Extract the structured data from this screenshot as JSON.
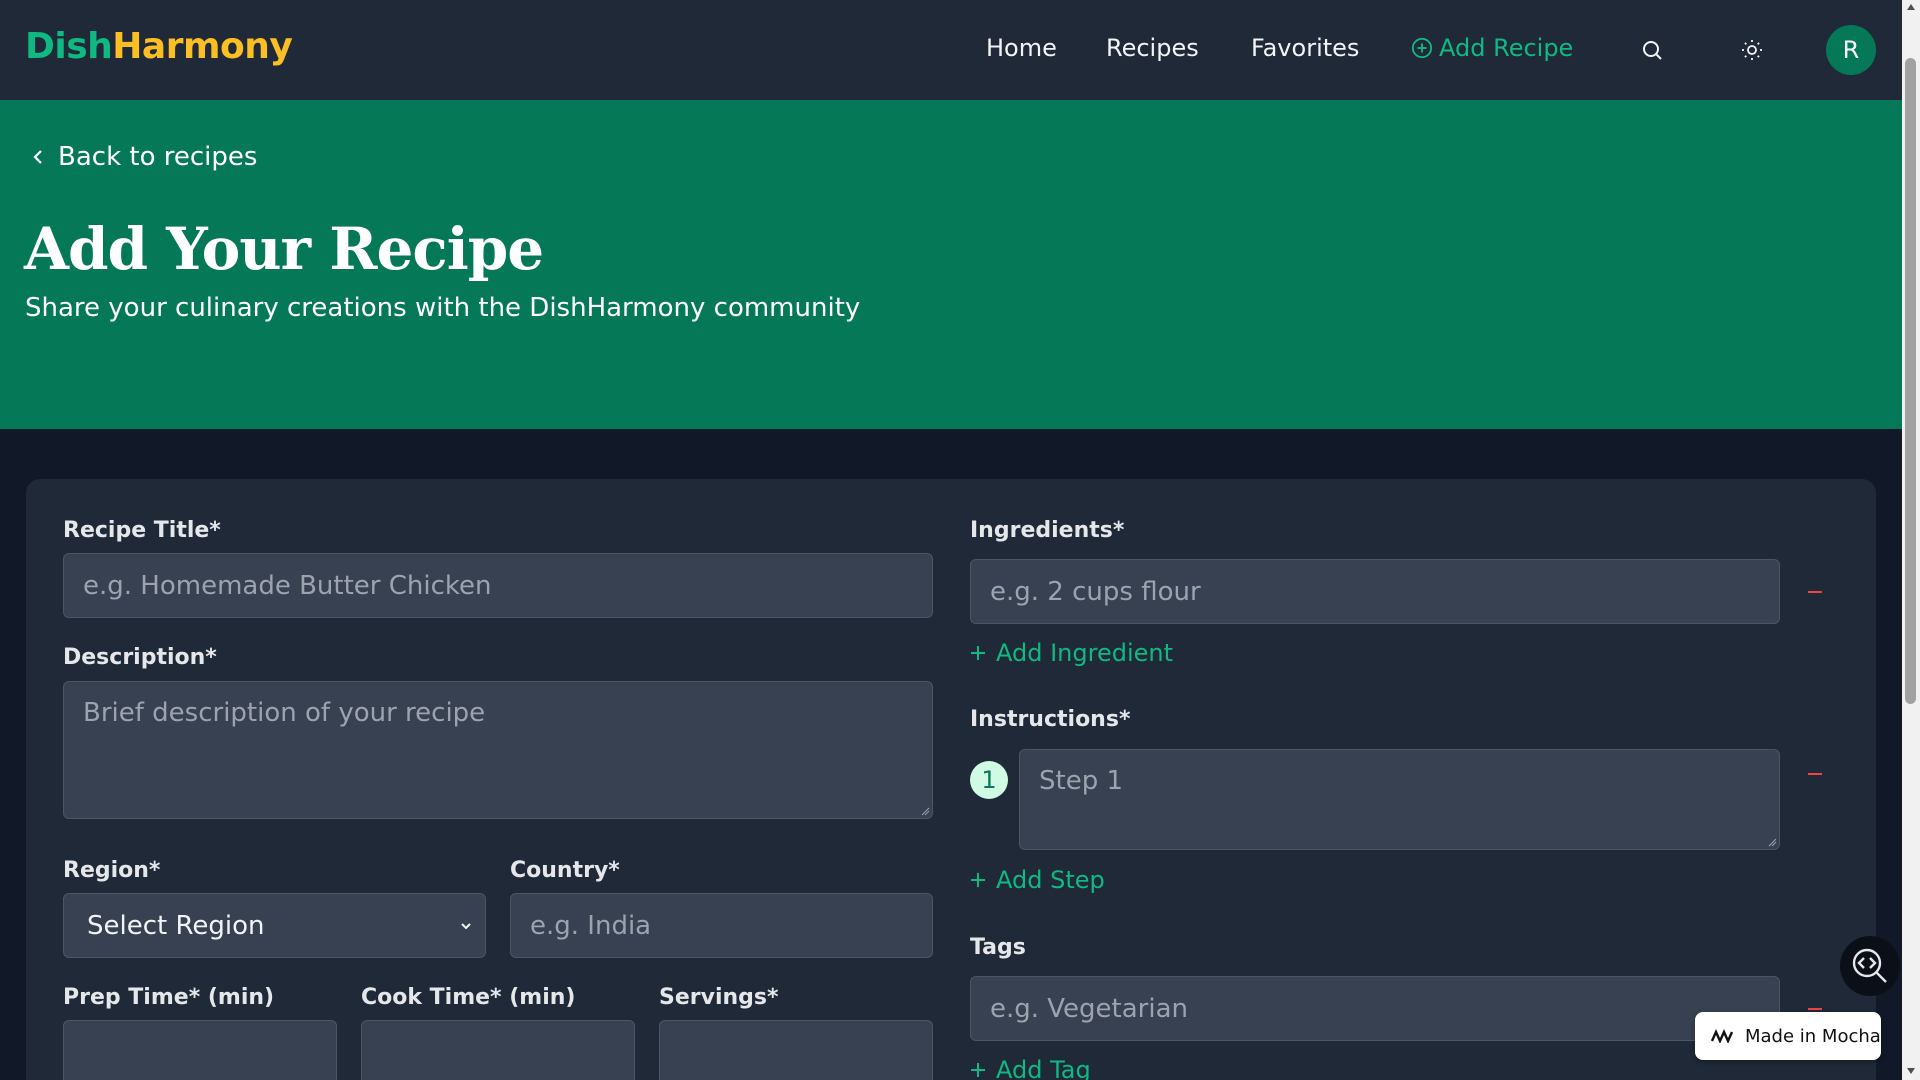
{
  "header": {
    "logo_part1": "Dish",
    "logo_part2": "Harmony",
    "nav": {
      "home": "Home",
      "recipes": "Recipes",
      "favorites": "Favorites",
      "add_recipe": "Add Recipe"
    },
    "avatar_initial": "R"
  },
  "hero": {
    "back_label": "Back to recipes",
    "title": "Add Your Recipe",
    "subtitle": "Share your culinary creations with the DishHarmony community"
  },
  "form": {
    "title_label": "Recipe Title*",
    "title_placeholder": "e.g. Homemade Butter Chicken",
    "description_label": "Description*",
    "description_placeholder": "Brief description of your recipe",
    "region_label": "Region*",
    "region_selected": "Select Region",
    "country_label": "Country*",
    "country_placeholder": "e.g. India",
    "prep_label": "Prep Time* (min)",
    "cook_label": "Cook Time* (min)",
    "servings_label": "Servings*",
    "ingredients_label": "Ingredients*",
    "ingredient_placeholder": "e.g. 2 cups flour",
    "add_ingredient": "Add Ingredient",
    "instructions_label": "Instructions*",
    "step_number": "1",
    "step_placeholder": "Step 1",
    "add_step": "Add Step",
    "tags_label": "Tags",
    "tag_placeholder": "e.g. Vegetarian",
    "add_tag": "Add Tag"
  },
  "badge": {
    "made_in": "Made in Mocha"
  },
  "colors": {
    "brand_green": "#10b981",
    "brand_yellow": "#fbbf24",
    "hero_bg": "#057857",
    "danger": "#ef4444"
  },
  "icons": [
    "search-icon",
    "sun-icon",
    "plus-circle-icon",
    "chevron-left-icon",
    "chevron-down-icon",
    "plus-icon",
    "minus-icon",
    "code-search-icon",
    "mocha-logo-icon"
  ]
}
